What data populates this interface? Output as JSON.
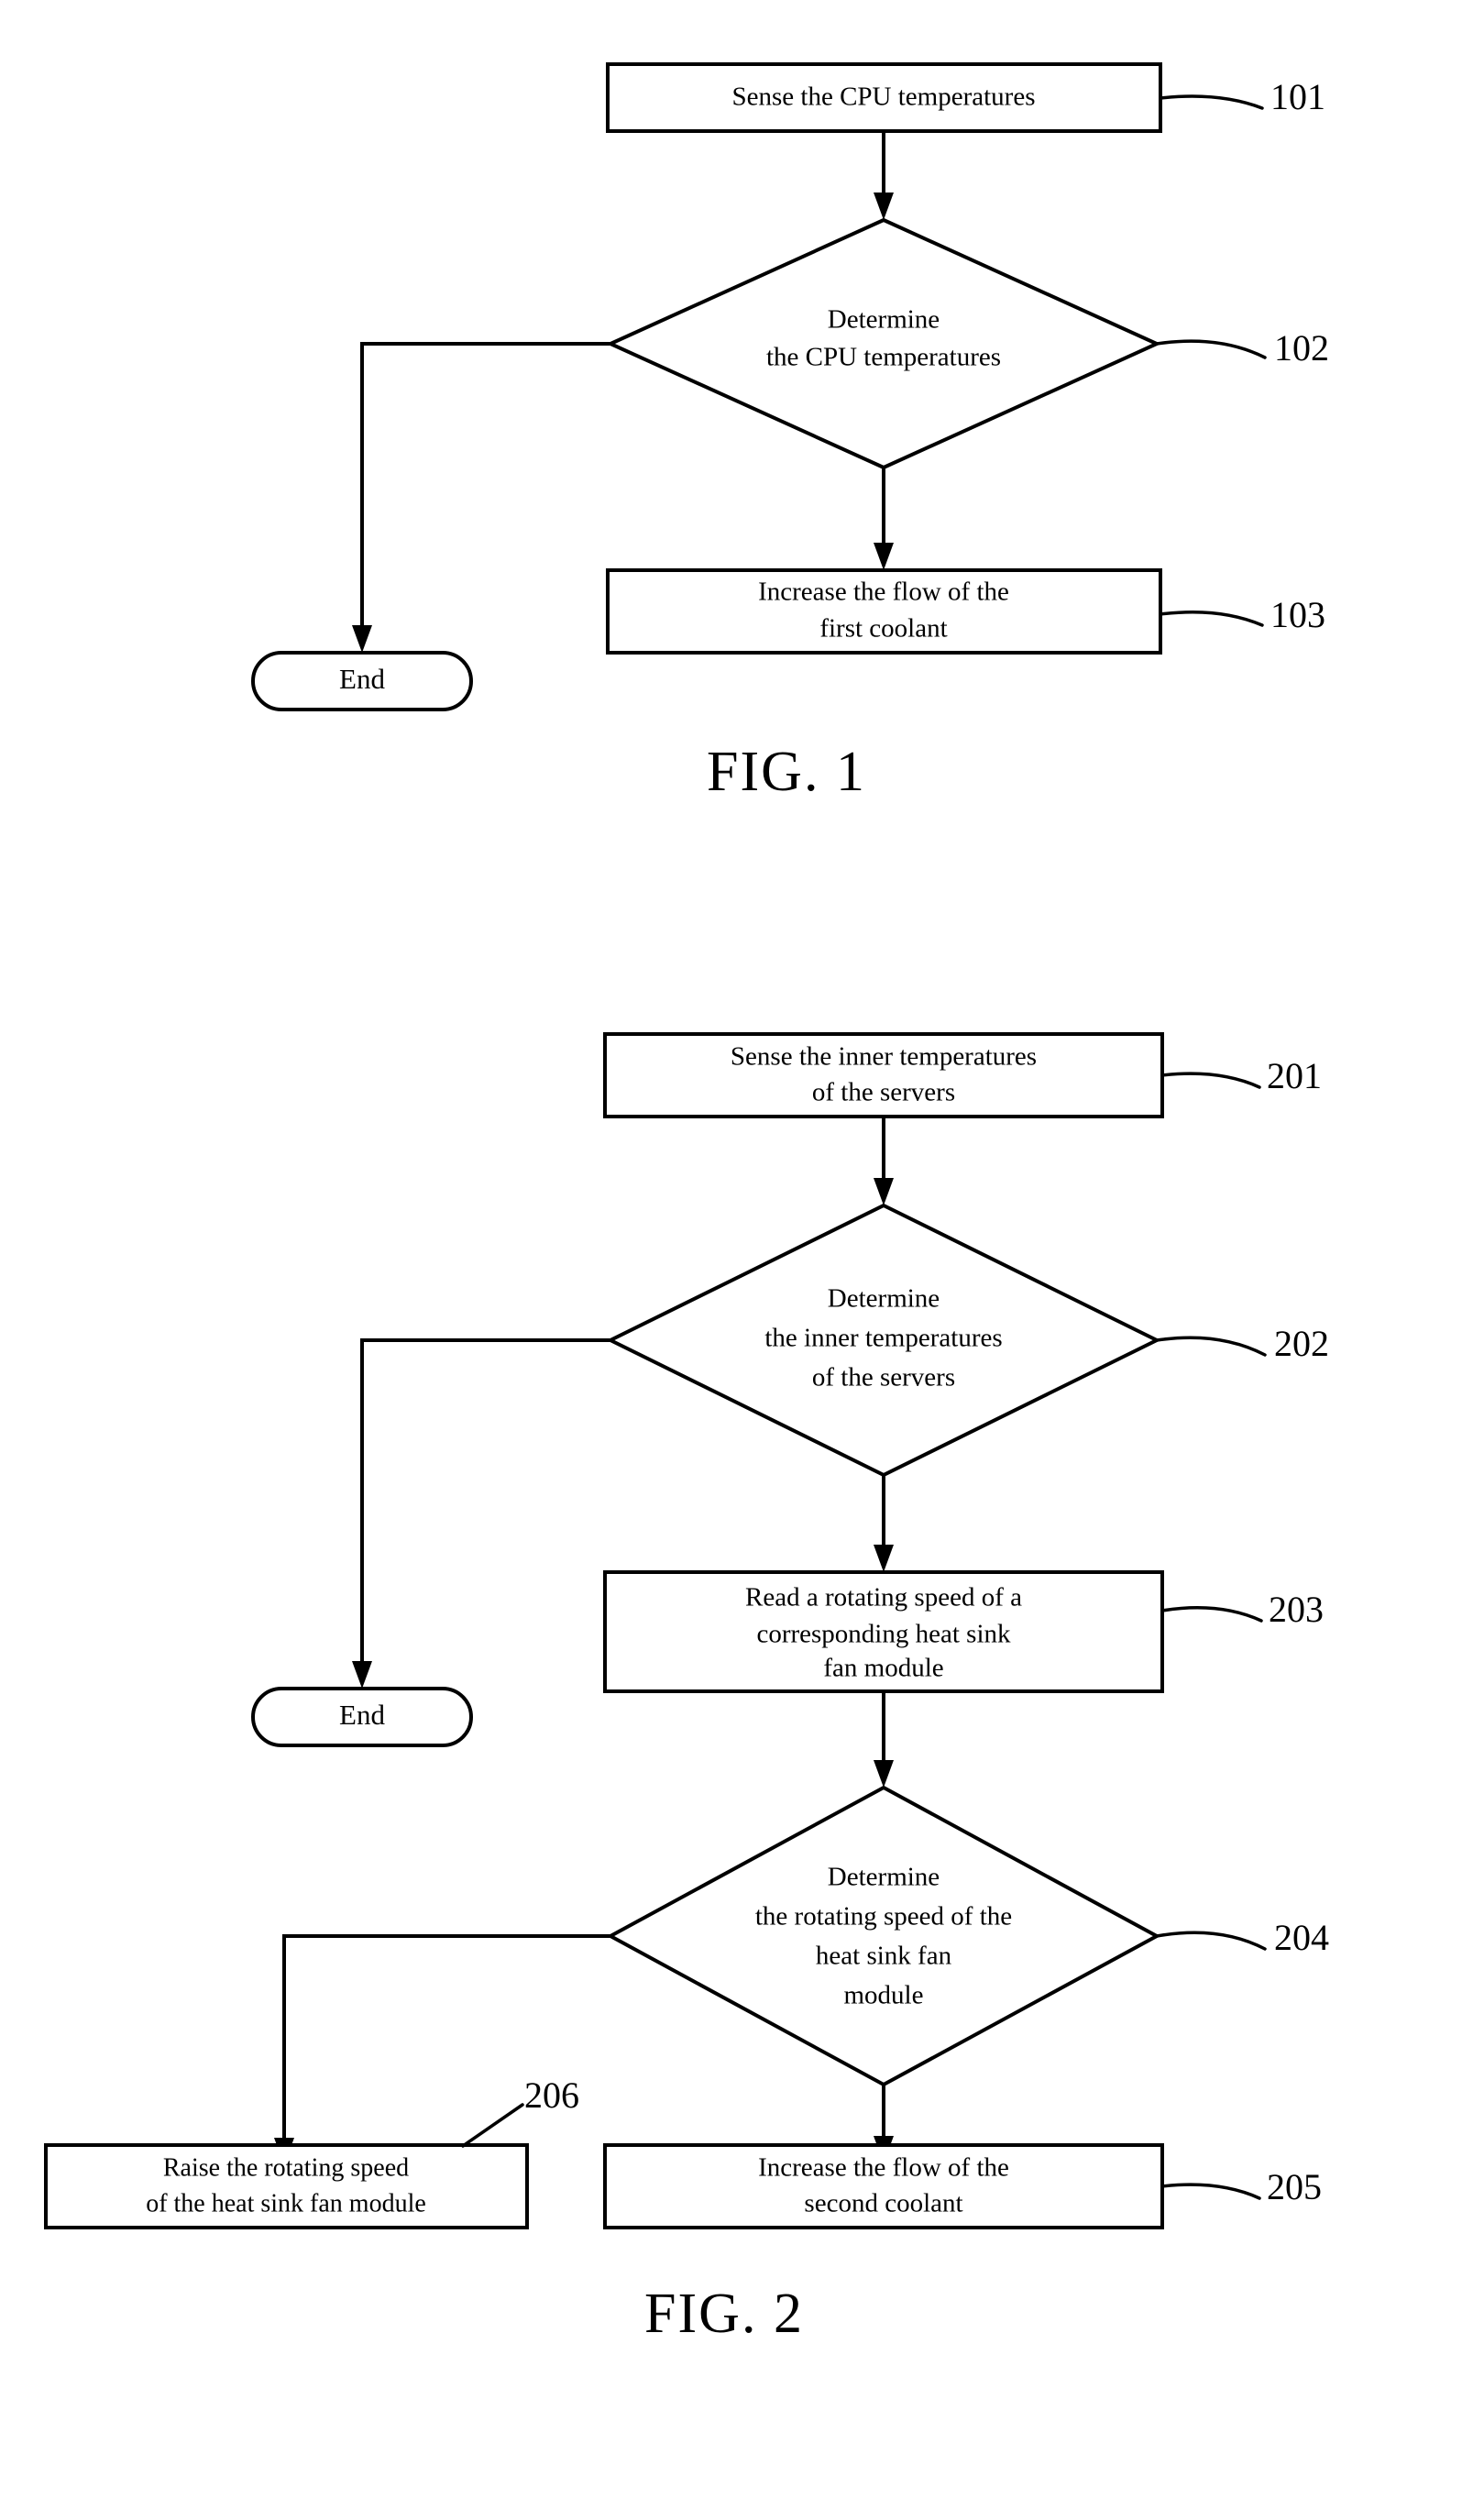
{
  "document": {
    "type": "patent-flowchart-sheet",
    "ink_color": "#000000",
    "background_color": "#ffffff"
  },
  "figures": [
    {
      "caption": "FIG. 1",
      "nodes": [
        {
          "id": "101",
          "shape": "process-box",
          "ref": "101",
          "lines": [
            "Sense the CPU temperatures"
          ]
        },
        {
          "id": "102",
          "shape": "decision-diamond",
          "ref": "102",
          "lines": [
            "Determine",
            "the CPU temperatures"
          ]
        },
        {
          "id": "103",
          "shape": "process-box",
          "ref": "103",
          "lines": [
            "Increase the flow of the",
            "first coolant"
          ]
        },
        {
          "id": "end1",
          "shape": "terminator-oval",
          "ref": "",
          "lines": [
            "End"
          ]
        }
      ]
    },
    {
      "caption": "FIG. 2",
      "nodes": [
        {
          "id": "201",
          "shape": "process-box",
          "ref": "201",
          "lines": [
            "Sense the inner temperatures",
            "of the servers"
          ]
        },
        {
          "id": "202",
          "shape": "decision-diamond",
          "ref": "202",
          "lines": [
            "Determine",
            "the inner temperatures",
            "of the servers"
          ]
        },
        {
          "id": "203",
          "shape": "process-box",
          "ref": "203",
          "lines": [
            "Read a rotating speed of a",
            "corresponding heat sink",
            "fan module"
          ]
        },
        {
          "id": "204",
          "shape": "decision-diamond",
          "ref": "204",
          "lines": [
            "Determine",
            "the rotating speed of the",
            "heat sink fan",
            "module"
          ]
        },
        {
          "id": "205",
          "shape": "process-box",
          "ref": "205",
          "lines": [
            "Increase the flow of the",
            "second coolant"
          ]
        },
        {
          "id": "206",
          "shape": "process-box",
          "ref": "206",
          "lines": [
            "Raise the rotating speed",
            "of the heat sink fan module"
          ]
        },
        {
          "id": "end2",
          "shape": "terminator-oval",
          "ref": "",
          "lines": [
            "End"
          ]
        }
      ]
    }
  ],
  "fig1": {
    "caption": "FIG. 1",
    "n101": {
      "ref": "101",
      "l1": "Sense the CPU temperatures"
    },
    "n102": {
      "ref": "102",
      "l1": "Determine",
      "l2": "the CPU temperatures"
    },
    "n103": {
      "ref": "103",
      "l1": "Increase the flow of the",
      "l2": "first coolant"
    },
    "end": {
      "label": "End"
    }
  },
  "fig2": {
    "caption": "FIG. 2",
    "n201": {
      "ref": "201",
      "l1": "Sense the inner temperatures",
      "l2": "of the servers"
    },
    "n202": {
      "ref": "202",
      "l1": "Determine",
      "l2": "the inner temperatures",
      "l3": "of the servers"
    },
    "n203": {
      "ref": "203",
      "l1": "Read a rotating speed of a",
      "l2": "corresponding heat sink",
      "l3": "fan module"
    },
    "n204": {
      "ref": "204",
      "l1": "Determine",
      "l2": "the rotating speed of the",
      "l3": "heat sink fan",
      "l4": "module"
    },
    "n205": {
      "ref": "205",
      "l1": "Increase the flow of the",
      "l2": "second coolant"
    },
    "n206": {
      "ref": "206",
      "l1": "Raise the rotating speed",
      "l2": "of the heat sink fan module"
    },
    "end": {
      "label": "End"
    }
  }
}
